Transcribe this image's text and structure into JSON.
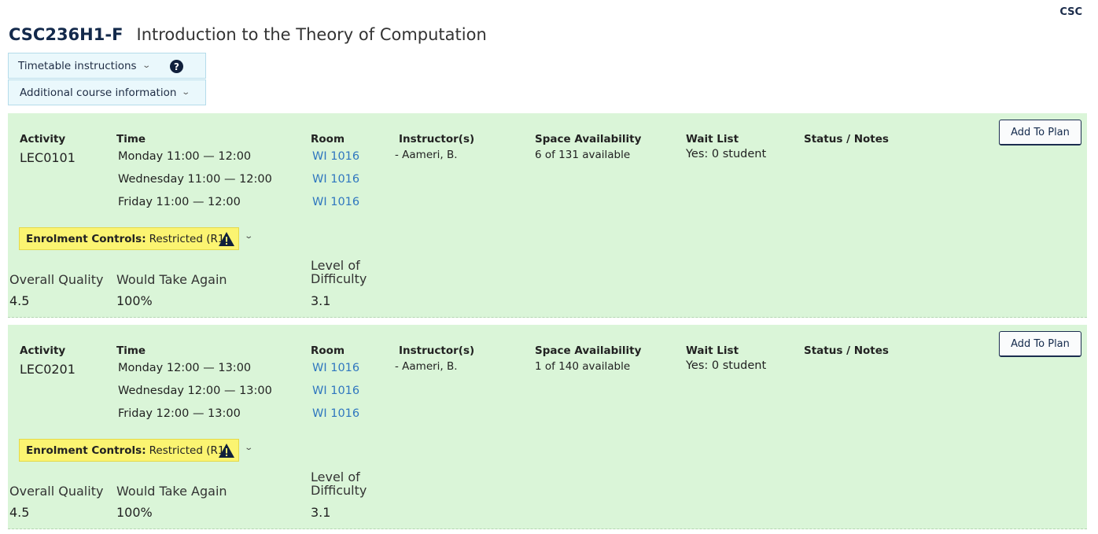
{
  "dept_code": "CSC",
  "course": {
    "code": "CSC236H1-F",
    "title": "Introduction to the Theory of Computation"
  },
  "info_boxes": {
    "timetable_instructions": "Timetable instructions",
    "additional_info": "Additional course information",
    "help_glyph": "?"
  },
  "headers": {
    "activity": "Activity",
    "time": "Time",
    "room": "Room",
    "instructors": "Instructor(s)",
    "space": "Space Availability",
    "waitlist": "Wait List",
    "status": "Status / Notes"
  },
  "ratings_labels": {
    "quality": "Overall Quality",
    "again": "Would Take Again",
    "difficulty_line1": "Level of",
    "difficulty_line2": "Difficulty"
  },
  "sections": [
    {
      "activity": "LEC0101",
      "times": [
        "Monday 11:00 — 12:00",
        "Wednesday 11:00 — 12:00",
        "Friday 11:00 — 12:00"
      ],
      "rooms": [
        "WI 1016",
        "WI 1016",
        "WI 1016"
      ],
      "instructor": "- Aameri, B.",
      "space": "6 of 131 available",
      "waitlist": "Yes: 0 student",
      "add_label": "Add To Plan",
      "enrolment_label": "Enrolment Controls:",
      "enrolment_value": "Restricted (R1)",
      "quality": "4.5",
      "again": "100%",
      "difficulty": "3.1"
    },
    {
      "activity": "LEC0201",
      "times": [
        "Monday 12:00 — 13:00",
        "Wednesday 12:00 — 13:00",
        "Friday 12:00 — 13:00"
      ],
      "rooms": [
        "WI 1016",
        "WI 1016",
        "WI 1016"
      ],
      "instructor": "- Aameri, B.",
      "space": "1 of 140 available",
      "waitlist": "Yes: 0 student",
      "add_label": "Add To Plan",
      "enrolment_label": "Enrolment Controls:",
      "enrolment_value": "Restricted (R1)",
      "quality": "4.5",
      "again": "100%",
      "difficulty": "3.1"
    }
  ],
  "colors": {
    "section_bg": "#daf5d8",
    "enrolment_bg": "#fbf471",
    "info_box_bg": "#eaf8fc",
    "room_link": "#2f76bf",
    "title_navy": "#13294b"
  },
  "icons": {
    "help": "help-icon",
    "warning": "warning-icon",
    "chevron": "chevron-down-icon"
  }
}
